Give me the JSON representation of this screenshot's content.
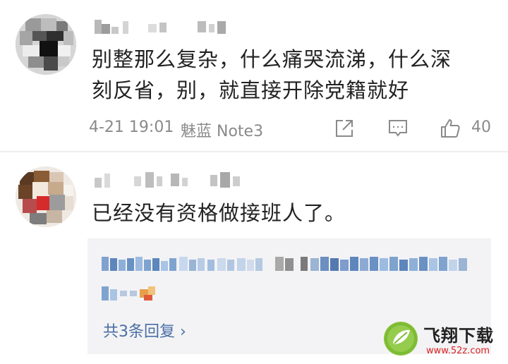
{
  "comments": [
    {
      "text_line1": "别整那么复杂，什么痛哭流涕，什么深",
      "text_line2": "刻反省，别，就直接开除党籍就好",
      "time": "4-21 19:01",
      "device": "魅蓝 Note3",
      "like_count": "40"
    },
    {
      "text": "已经没有资格做接班人了。",
      "more_replies": "共3条回复 ›"
    }
  ],
  "icons": {
    "share": "share-icon",
    "reply": "comment-icon",
    "like": "thumbs-up-icon",
    "logo": "leaf-logo"
  },
  "watermark": {
    "title": "飞翔下载",
    "url": "www.52z.com"
  },
  "colors": {
    "text": "#222222",
    "meta": "#8a8a8a",
    "link": "#4a6fa5",
    "reply_bg": "#f3f3f5"
  }
}
